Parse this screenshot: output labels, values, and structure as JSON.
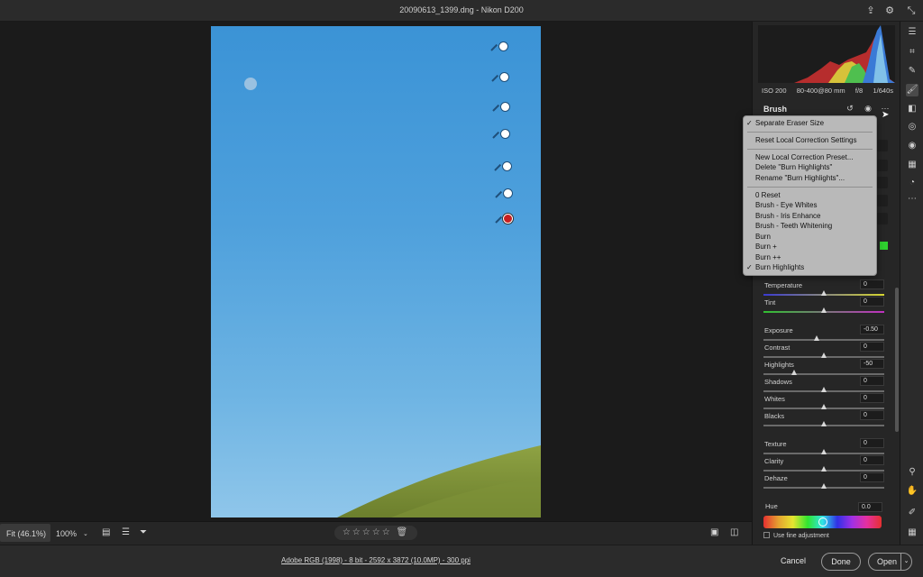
{
  "window": {
    "title": "20090613_1399.dng  -  Nikon D200"
  },
  "titlebar_icons": {
    "export": "export-icon",
    "settings": "gear-icon",
    "collapse": "collapse-icon"
  },
  "viewbar": {
    "fit_label": "Fit (46.1%)",
    "zoom_label": "100%",
    "stars": "☆☆☆☆☆",
    "icons": [
      "image-icon",
      "sort-icon",
      "filter-icon",
      "compare-icon",
      "split-view-icon"
    ]
  },
  "footer": {
    "workflow_link": "Adobe RGB (1998) - 8 bit - 2592 x 3872 (10.0MP) - 300 ppi",
    "cancel_label": "Cancel",
    "done_label": "Done",
    "open_label": "Open"
  },
  "camera_info": {
    "iso": "ISO 200",
    "lens": "80-400@80 mm",
    "aperture": "f/8",
    "shutter": "1/640s"
  },
  "brush_panel": {
    "title": "Brush",
    "sliders": [
      {
        "label": "Temperature",
        "value": "0",
        "pos": 0.5
      },
      {
        "label": "Tint",
        "value": "0",
        "pos": 0.5
      },
      {
        "label": "Exposure",
        "value": "-0.50",
        "pos": 0.44
      },
      {
        "label": "Contrast",
        "value": "0",
        "pos": 0.5
      },
      {
        "label": "Highlights",
        "value": "-50",
        "pos": 0.25
      },
      {
        "label": "Shadows",
        "value": "0",
        "pos": 0.5
      },
      {
        "label": "Whites",
        "value": "0",
        "pos": 0.5
      },
      {
        "label": "Blacks",
        "value": "0",
        "pos": 0.5
      },
      {
        "label": "Texture",
        "value": "0",
        "pos": 0.5
      },
      {
        "label": "Clarity",
        "value": "0",
        "pos": 0.5
      },
      {
        "label": "Dehaze",
        "value": "0",
        "pos": 0.5
      }
    ],
    "hue": {
      "label": "Hue",
      "value": "0.0"
    },
    "fine_adjustment_label": "Use fine adjustment"
  },
  "menu": {
    "items": [
      {
        "label": "Separate Eraser Size",
        "checked": true
      },
      {
        "label": "Reset Local Correction Settings",
        "checked": false
      },
      {
        "label": "New Local Correction Preset...",
        "checked": false
      },
      {
        "label": "Delete \"Burn Highlights\"",
        "checked": false
      },
      {
        "label": "Rename \"Burn Highlights\"...",
        "checked": false
      },
      {
        "label": "0 Reset",
        "checked": false
      },
      {
        "label": "Brush - Eye Whites",
        "checked": false
      },
      {
        "label": "Brush - Iris Enhance",
        "checked": false
      },
      {
        "label": "Brush - Teeth Whitening",
        "checked": false
      },
      {
        "label": "Burn",
        "checked": false
      },
      {
        "label": "Burn +",
        "checked": false
      },
      {
        "label": "Burn ++",
        "checked": false
      },
      {
        "label": "Burn Highlights",
        "checked": true
      }
    ]
  },
  "right_toolbar": {
    "icons": [
      "edit-sliders-icon",
      "crop-icon",
      "healing-icon",
      "brush-icon",
      "gradient-icon",
      "radial-icon",
      "redeye-icon",
      "presets-icon",
      "snapshots-icon",
      "more-icon",
      "zoom-icon",
      "hand-icon",
      "sampler-icon",
      "grid-icon"
    ]
  },
  "colors": {
    "accent_green": "#2fd12f",
    "active_pin": "#c81f1f"
  }
}
